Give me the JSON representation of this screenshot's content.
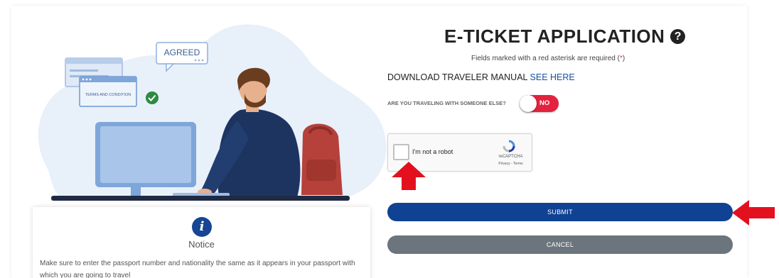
{
  "illustration": {
    "agreed_label": "AGREED",
    "terms_label": "TERMS AND CONDITION"
  },
  "notice": {
    "icon": "info-icon",
    "title": "Notice",
    "text": "Make sure to enter the passport number and nationality the same as it appears in your passport with which you are going to travel"
  },
  "form": {
    "title": "E-TICKET APPLICATION",
    "help_icon": "?",
    "required_text": "Fields marked with a red asterisk are required (",
    "required_asterisk": "*",
    "required_close": ")",
    "download_label": "DOWNLOAD TRAVELER MANUAL",
    "download_link": "SEE HERE",
    "traveling_label": "ARE YOU TRAVELING WITH SOMEONE ELSE?",
    "traveling_toggle": "NO",
    "captcha": {
      "label": "I'm not a robot",
      "brand": "reCAPTCHA",
      "privacy": "Privacy - Terms"
    },
    "submit_label": "SUBMIT",
    "cancel_label": "CANCEL"
  },
  "colors": {
    "primary": "#0f4293",
    "toggle_red": "#e3223d",
    "cancel_gray": "#6c757d",
    "arrow_red": "#e3101e"
  }
}
